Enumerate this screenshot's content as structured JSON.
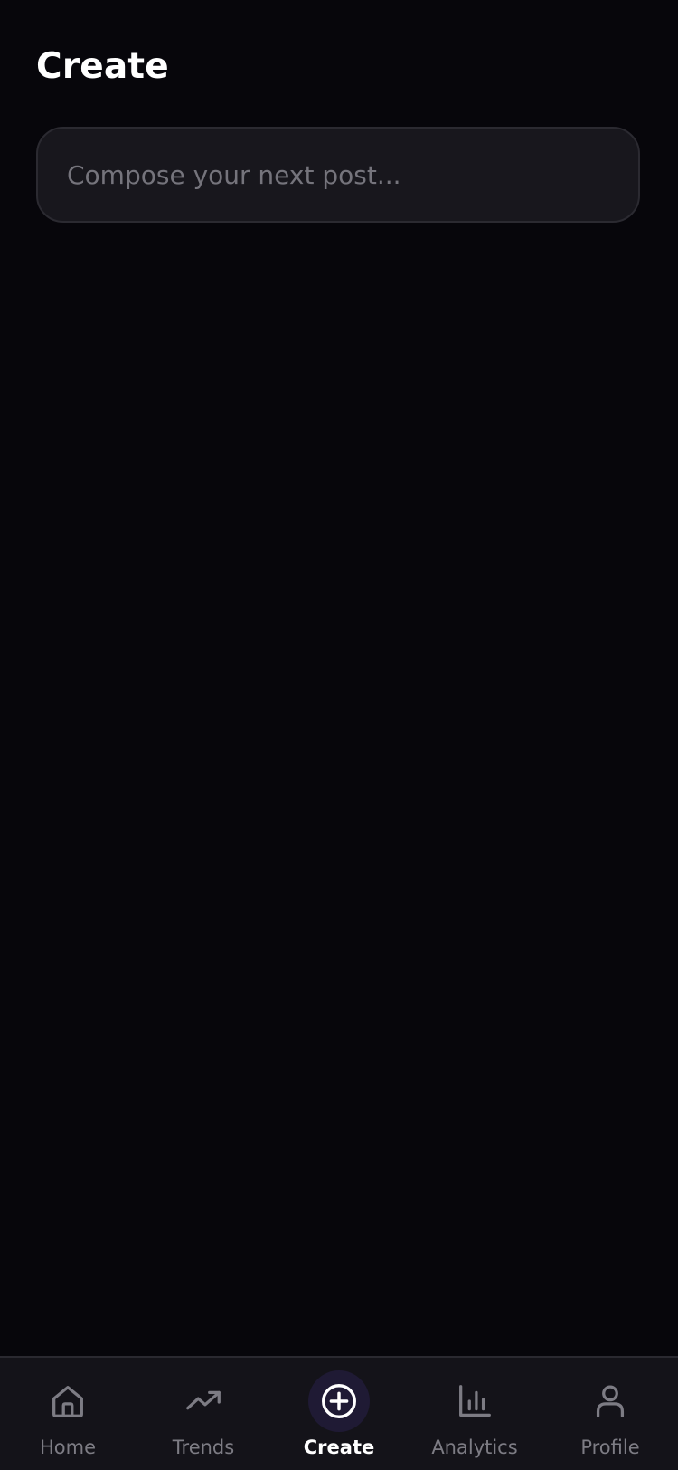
{
  "header": {
    "title": "Create"
  },
  "compose": {
    "placeholder": "Compose your next post..."
  },
  "tabbar": {
    "active": "Create",
    "colors": {
      "inactive": "#7d7c84",
      "active": "#ffffff",
      "active_bg": "#1f1a34",
      "background": "#141319"
    },
    "tabs": [
      {
        "label": "Home",
        "icon": "home-icon"
      },
      {
        "label": "Trends",
        "icon": "trending-up-icon"
      },
      {
        "label": "Create",
        "icon": "plus-circle-icon"
      },
      {
        "label": "Analytics",
        "icon": "bar-chart-icon"
      },
      {
        "label": "Profile",
        "icon": "user-icon"
      }
    ]
  }
}
